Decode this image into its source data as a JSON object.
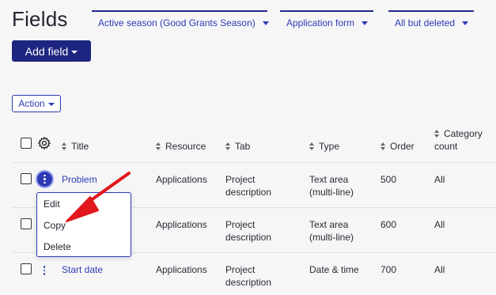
{
  "page": {
    "title": "Fields"
  },
  "filters": [
    {
      "label": "Active season (Good Grants Season)"
    },
    {
      "label": "Application form"
    },
    {
      "label": "All but deleted"
    }
  ],
  "toolbar": {
    "add_field_label": "Add field",
    "action_label": "Action"
  },
  "table": {
    "headers": {
      "title": "Title",
      "resource": "Resource",
      "tab": "Tab",
      "type": "Type",
      "order": "Order",
      "category_line1": "Category",
      "category_line2": "count"
    },
    "rows": [
      {
        "title": "Problem",
        "resource": "Applications",
        "tab_line1": "Project",
        "tab_line2": "description",
        "type_line1": "Text area",
        "type_line2": "(multi-line)",
        "order": "500",
        "category": "All"
      },
      {
        "title": "",
        "resource": "Applications",
        "tab_line1": "Project",
        "tab_line2": "description",
        "type_line1": "Text area",
        "type_line2": "(multi-line)",
        "order": "600",
        "category": "All"
      },
      {
        "title": "Start date",
        "resource": "Applications",
        "tab_line1": "Project",
        "tab_line2": "description",
        "type_line1": "Date & time",
        "type_line2": "",
        "order": "700",
        "category": "All"
      }
    ]
  },
  "row_menu": {
    "edit": "Edit",
    "copy": "Copy",
    "delete": "Delete"
  },
  "colors": {
    "primary": "#1d2580",
    "link": "#2d3ab3",
    "annotation_arrow": "#e0171c"
  },
  "icons": {
    "settings": "gear-icon",
    "row_actions": "kebab-icon",
    "annotation": "red-arrow-icon"
  }
}
